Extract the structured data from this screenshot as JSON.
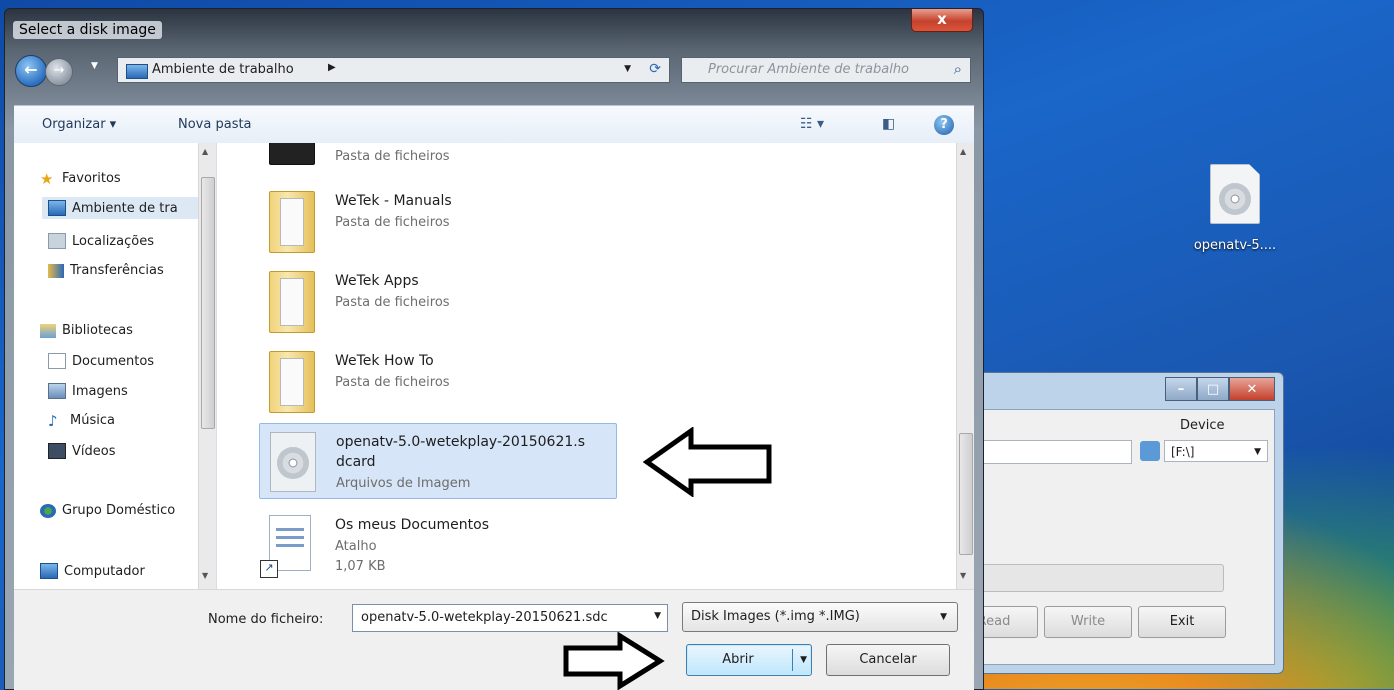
{
  "desktop": {
    "icon_label": "openatv-5...."
  },
  "tool_window": {
    "device_label": "Device",
    "device_value": "[F:\\]",
    "buttons": [
      "Read",
      "Write",
      "Exit"
    ]
  },
  "dialog": {
    "title": "Select a disk image",
    "close_label": "x",
    "address": "Ambiente de trabalho",
    "search_placeholder": "Procurar Ambiente de trabalho",
    "toolbar": {
      "organize": "Organizar ▾",
      "new_folder": "Nova pasta"
    },
    "nav": {
      "favorites": "Favoritos",
      "desktop": "Ambiente de tra",
      "places": "Localizações",
      "downloads": "Transferências",
      "libraries": "Bibliotecas",
      "documents": "Documentos",
      "images": "Imagens",
      "music": "Música",
      "videos": "Vídeos",
      "homegroup": "Grupo Doméstico",
      "computer": "Computador"
    },
    "files": [
      {
        "name": "",
        "type": "Pasta de ficheiros",
        "size": ""
      },
      {
        "name": "WeTek - Manuals",
        "type": "Pasta de ficheiros",
        "size": ""
      },
      {
        "name": "WeTek Apps",
        "type": "Pasta de ficheiros",
        "size": ""
      },
      {
        "name": "WeTek How To",
        "type": "Pasta de ficheiros",
        "size": ""
      },
      {
        "name": "openatv-5.0-wetekplay-20150621.s",
        "name2": "dcard",
        "type": "Arquivos de Imagem",
        "size": ""
      },
      {
        "name": "Os meus Documentos",
        "type": "Atalho",
        "size": "1,07 KB"
      }
    ],
    "filename_label": "Nome do ficheiro:",
    "filename_value": "openatv-5.0-wetekplay-20150621.sdc",
    "filter_value": "Disk Images (*.img *.IMG)",
    "open_button": "Abrir",
    "cancel_button": "Cancelar"
  },
  "colors": {
    "selection": "#d6e5f7",
    "accent": "#3c7fb1"
  }
}
